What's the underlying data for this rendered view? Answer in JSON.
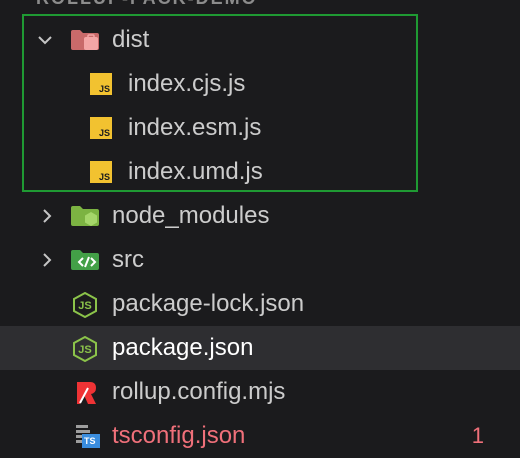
{
  "header": {
    "title": "ROLLUP-PACK-DEMO"
  },
  "tree": {
    "dist": {
      "label": "dist",
      "expanded": true
    },
    "dist_files": [
      {
        "label": "index.cjs.js",
        "icon": "js-file-icon"
      },
      {
        "label": "index.esm.js",
        "icon": "js-file-icon"
      },
      {
        "label": "index.umd.js",
        "icon": "js-file-icon"
      }
    ],
    "node_modules": {
      "label": "node_modules",
      "expanded": false
    },
    "src": {
      "label": "src",
      "expanded": false
    },
    "package_lock": {
      "label": "package-lock.json"
    },
    "package_json": {
      "label": "package.json",
      "selected": true
    },
    "rollup_config": {
      "label": "rollup.config.mjs"
    },
    "tsconfig": {
      "label": "tsconfig.json",
      "problems": "1"
    }
  },
  "colors": {
    "background": "#1b1b1d",
    "selected_row": "#2e2e31",
    "highlight_border": "#1f9a33",
    "error_text": "#f0707a",
    "js_icon": "#f2c230",
    "json_icon": "#8bc34a",
    "dist_folder": "#e88f8f",
    "node_modules_folder": "#8bc34a",
    "src_folder": "#4caf50",
    "rollup_icon": "#ef3335",
    "ts_icon": "#3a8dde"
  }
}
